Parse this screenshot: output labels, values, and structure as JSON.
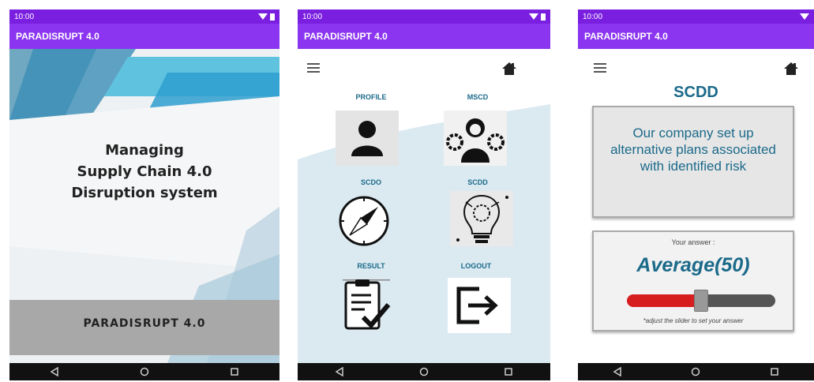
{
  "status_time": "10:00",
  "app_title": "PARADISRUPT 4.0",
  "splash": {
    "title_line1": "Managing",
    "title_line2": "Supply Chain 4.0",
    "title_line3": "Disruption system",
    "brand": "PARADISRUPT 4.0"
  },
  "menu": {
    "tiles": [
      {
        "label": "PROFILE",
        "icon": "person-icon"
      },
      {
        "label": "MSCD",
        "icon": "manager-gears-icon"
      },
      {
        "label": "SCDO",
        "icon": "compass-icon"
      },
      {
        "label": "SCDD",
        "icon": "lightbulb-circuit-icon"
      },
      {
        "label": "RESULT",
        "icon": "clipboard-check-icon"
      },
      {
        "label": "LOGOUT",
        "icon": "logout-icon"
      }
    ]
  },
  "scdd": {
    "title": "SCDD",
    "question": "Our company set up alternative plans associated with identified risk",
    "answer_label": "Your answer :",
    "answer_value": "Average(50)",
    "slider_value_fraction": 0.5,
    "hint": "*adjust the slider to set your answer"
  },
  "colors": {
    "status_bar": "#7a1fe0",
    "app_bar": "#8b35f0",
    "accent_teal": "#1b6a8a",
    "slider_red": "#d61e1e"
  }
}
